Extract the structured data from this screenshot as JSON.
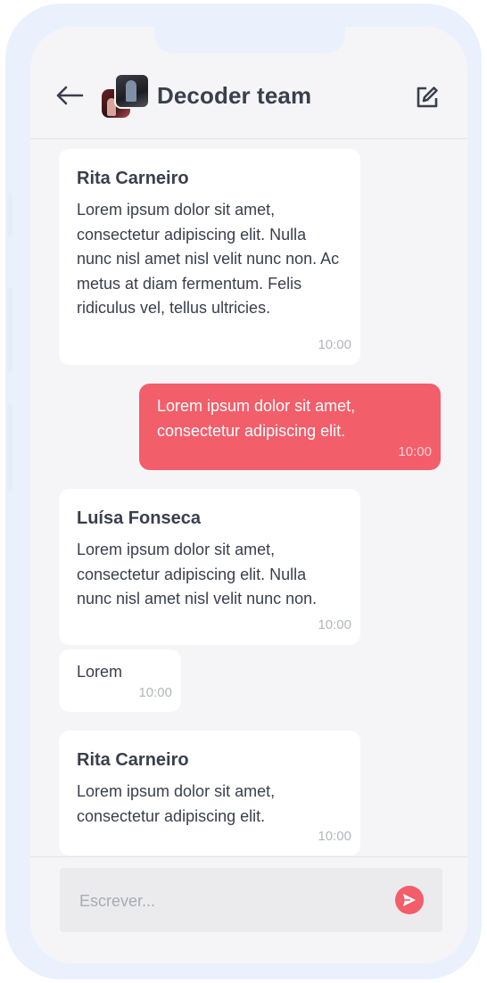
{
  "header": {
    "title": "Decoder team",
    "back_icon": "arrow-left-icon",
    "edit_icon": "edit-icon"
  },
  "messages": [
    {
      "sender": "Rita Carneiro",
      "text": "Lorem ipsum dolor sit amet, consectetur adipiscing elit. Nulla nunc nisl amet nisl velit nunc non. Ac metus at diam fermentum. Felis ridiculus vel, tellus ultricies.",
      "time": "10:00",
      "mine": false
    },
    {
      "sender": "",
      "text": "Lorem ipsum dolor sit amet, consectetur adipiscing elit.",
      "time": "10:00",
      "mine": true
    },
    {
      "sender": "Luísa Fonseca",
      "text": "Lorem ipsum dolor sit amet, consectetur adipiscing elit. Nulla nunc nisl amet nisl velit nunc non.",
      "time": "10:00",
      "mine": false
    },
    {
      "sender": "",
      "text": "Lorem",
      "time": "10:00",
      "mine": false
    },
    {
      "sender": "Rita Carneiro",
      "text": "Lorem ipsum dolor sit amet, consectetur adipiscing elit.",
      "time": "10:00",
      "mine": false
    }
  ],
  "composer": {
    "placeholder": "Escrever...",
    "value": "",
    "send_icon": "send-icon"
  },
  "colors": {
    "accent": "#f25e6a",
    "text": "#3a3f4d",
    "frame": "#eaf1fd",
    "background": "#f5f5f7"
  }
}
